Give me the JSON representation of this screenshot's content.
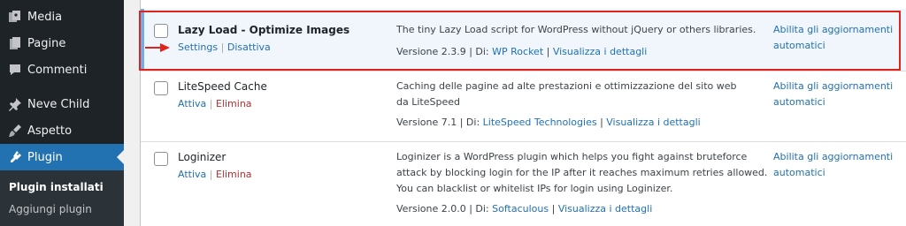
{
  "sidebar": {
    "items": [
      {
        "label": "Media",
        "icon": "media-icon"
      },
      {
        "label": "Pagine",
        "icon": "pages-icon"
      },
      {
        "label": "Commenti",
        "icon": "comments-icon"
      },
      {
        "label": "Neve Child",
        "icon": "theme-pin-icon"
      },
      {
        "label": "Aspetto",
        "icon": "appearance-icon"
      },
      {
        "label": "Plugin",
        "icon": "plugin-icon"
      }
    ],
    "submenu": [
      "Plugin installati",
      "Aggiungi plugin"
    ]
  },
  "plugins": [
    {
      "name": "Lazy Load - Optimize Images",
      "actions": [
        "Settings",
        "Disattiva"
      ],
      "description": "The tiny Lazy Load script for WordPress without jQuery or others libraries.",
      "version_text": "Versione 2.3.9",
      "by_label": "Di:",
      "author": "WP Rocket",
      "details": "Visualizza i dettagli",
      "auto_update": "Abilita gli aggiornamenti automatici",
      "active": true
    },
    {
      "name": "LiteSpeed Cache",
      "actions": [
        "Attiva",
        "Elimina"
      ],
      "description": "Caching delle pagine ad alte prestazioni e ottimizzazione del sito web da LiteSpeed",
      "version_text": "Versione 7.1",
      "by_label": "Di:",
      "author": "LiteSpeed Technologies",
      "details": "Visualizza i dettagli",
      "auto_update": "Abilita gli aggiornamenti automatici",
      "active": false
    },
    {
      "name": "Loginizer",
      "actions": [
        "Attiva",
        "Elimina"
      ],
      "description": "Loginizer is a WordPress plugin which helps you fight against bruteforce attack by blocking login for the IP after it reaches maximum retries allowed. You can blacklist or whitelist IPs for login using Loginizer.",
      "version_text": "Versione 2.0.0",
      "by_label": "Di:",
      "author": "Softaculous",
      "details": "Visualizza i dettagli",
      "auto_update": "Abilita gli aggiornamenti automatici",
      "active": false
    }
  ],
  "colors": {
    "sidebar_bg": "#1d2327",
    "accent": "#2271b1",
    "annotation_red": "#e0231c",
    "delete_red": "#b32d2e"
  }
}
